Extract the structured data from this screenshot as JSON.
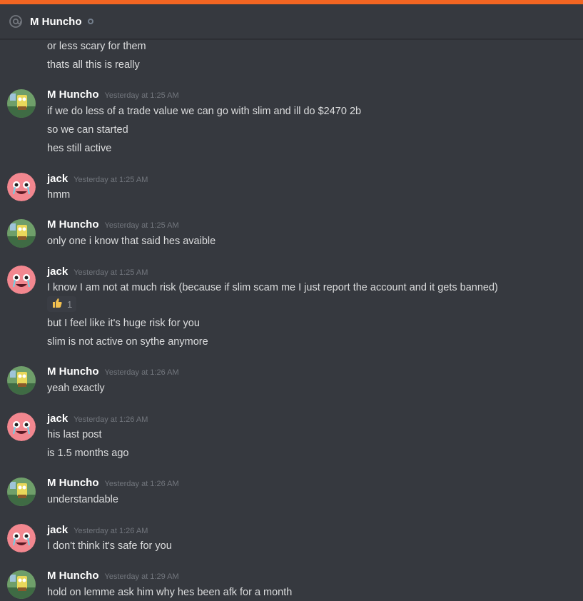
{
  "header": {
    "channel_name": "M Huncho",
    "icon": "at-icon",
    "status_icon": "offline-status-icon"
  },
  "colors": {
    "accent_bar": "#f26522",
    "background": "#36393f",
    "author": "#ffffff",
    "text": "#dcddde",
    "timestamp": "#72767d"
  },
  "groups": [
    {
      "author": "",
      "timestamp": "",
      "avatar": "",
      "lines": [
        "or less scary for them",
        "thats all this is really"
      ]
    },
    {
      "author": "M Huncho",
      "timestamp": "Yesterday at 1:25 AM",
      "avatar": "spongebob",
      "lines": [
        "if we do less of a trade value we can go with slim and ill do $2470 2b",
        "so we can started",
        "hes still active"
      ]
    },
    {
      "author": "jack",
      "timestamp": "Yesterday at 1:25 AM",
      "avatar": "pink-face",
      "lines": [
        "hmm"
      ]
    },
    {
      "author": "M Huncho",
      "timestamp": "Yesterday at 1:25 AM",
      "avatar": "spongebob",
      "lines": [
        "only one i know that said hes avaible"
      ]
    },
    {
      "author": "jack",
      "timestamp": "Yesterday at 1:25 AM",
      "avatar": "pink-face",
      "lines": [
        "I know I am not at much risk (because if slim scam me I just report the account and it gets banned)",
        "but I feel like it's huge risk for you",
        "slim is not active on sythe anymore"
      ],
      "reaction": {
        "emoji": "thumbs-up-icon",
        "count": "1"
      }
    },
    {
      "author": "M Huncho",
      "timestamp": "Yesterday at 1:26 AM",
      "avatar": "spongebob",
      "lines": [
        "yeah exactly"
      ]
    },
    {
      "author": "jack",
      "timestamp": "Yesterday at 1:26 AM",
      "avatar": "pink-face",
      "lines": [
        "his last post",
        "is 1.5 months ago"
      ]
    },
    {
      "author": "M Huncho",
      "timestamp": "Yesterday at 1:26 AM",
      "avatar": "spongebob",
      "lines": [
        "understandable"
      ]
    },
    {
      "author": "jack",
      "timestamp": "Yesterday at 1:26 AM",
      "avatar": "pink-face",
      "lines": [
        "I don't think it's safe for you"
      ]
    },
    {
      "author": "M Huncho",
      "timestamp": "Yesterday at 1:29 AM",
      "avatar": "spongebob",
      "lines": [
        "hold on lemme ask him why hes been afk for a month"
      ]
    }
  ]
}
